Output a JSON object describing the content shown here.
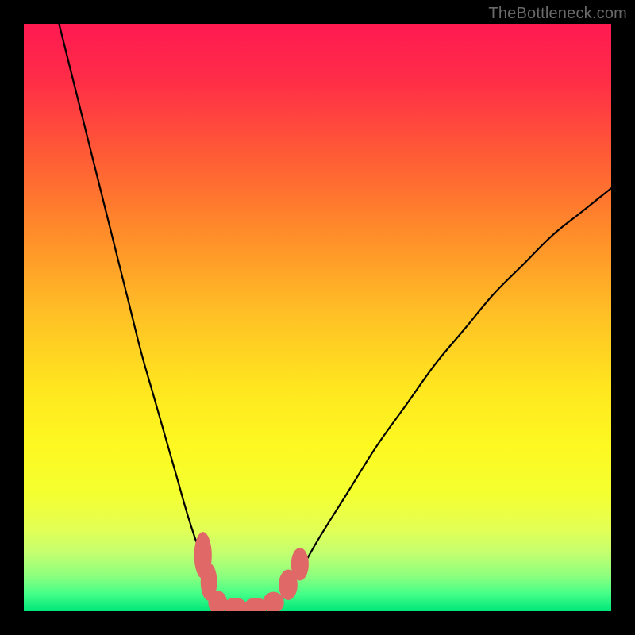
{
  "watermark": {
    "text": "TheBottleneck.com"
  },
  "colors": {
    "frame": "#000000",
    "gradient_stops": [
      {
        "pct": 0,
        "color": "#ff1951"
      },
      {
        "pct": 10,
        "color": "#ff2e47"
      },
      {
        "pct": 22,
        "color": "#ff5a36"
      },
      {
        "pct": 35,
        "color": "#ff8a2a"
      },
      {
        "pct": 50,
        "color": "#ffc225"
      },
      {
        "pct": 62,
        "color": "#ffe61f"
      },
      {
        "pct": 72,
        "color": "#fdf921"
      },
      {
        "pct": 80,
        "color": "#f4ff30"
      },
      {
        "pct": 86,
        "color": "#e3ff55"
      },
      {
        "pct": 90,
        "color": "#c4ff6f"
      },
      {
        "pct": 94,
        "color": "#8dff7e"
      },
      {
        "pct": 97,
        "color": "#45ff88"
      },
      {
        "pct": 100,
        "color": "#00e67a"
      }
    ],
    "curve": "#000000",
    "marker_fill": "#e06866",
    "marker_stroke": "#e06866"
  },
  "chart_data": {
    "type": "line",
    "title": "",
    "xlabel": "",
    "ylabel": "",
    "xlim": [
      0,
      100
    ],
    "ylim": [
      0,
      100
    ],
    "grid": false,
    "legend": false,
    "series": [
      {
        "name": "left-branch",
        "x": [
          6,
          8,
          10,
          12,
          14,
          16,
          18,
          20,
          22,
          24,
          26,
          28,
          30,
          32,
          33.5
        ],
        "y": [
          100,
          92,
          84,
          76,
          68,
          60,
          52,
          44,
          37,
          30,
          23,
          16,
          10,
          5,
          1
        ]
      },
      {
        "name": "floor",
        "x": [
          33.5,
          36,
          39,
          41,
          43
        ],
        "y": [
          1,
          0.5,
          0.5,
          0.5,
          1
        ]
      },
      {
        "name": "right-branch",
        "x": [
          43,
          46,
          50,
          55,
          60,
          65,
          70,
          75,
          80,
          85,
          90,
          95,
          100
        ],
        "y": [
          1,
          5,
          12,
          20,
          28,
          35,
          42,
          48,
          54,
          59,
          64,
          68,
          72
        ]
      }
    ],
    "markers": [
      {
        "x": 30.5,
        "y": 9.5,
        "rx": 1.5,
        "ry": 4.0
      },
      {
        "x": 31.5,
        "y": 5.0,
        "rx": 1.4,
        "ry": 3.2
      },
      {
        "x": 33.0,
        "y": 1.5,
        "rx": 1.6,
        "ry": 2.0
      },
      {
        "x": 36.0,
        "y": 0.8,
        "rx": 2.0,
        "ry": 1.5
      },
      {
        "x": 39.5,
        "y": 0.8,
        "rx": 2.0,
        "ry": 1.5
      },
      {
        "x": 42.5,
        "y": 1.5,
        "rx": 1.8,
        "ry": 1.8
      },
      {
        "x": 45.0,
        "y": 4.5,
        "rx": 1.6,
        "ry": 2.6
      },
      {
        "x": 47.0,
        "y": 8.0,
        "rx": 1.5,
        "ry": 2.8
      }
    ]
  }
}
